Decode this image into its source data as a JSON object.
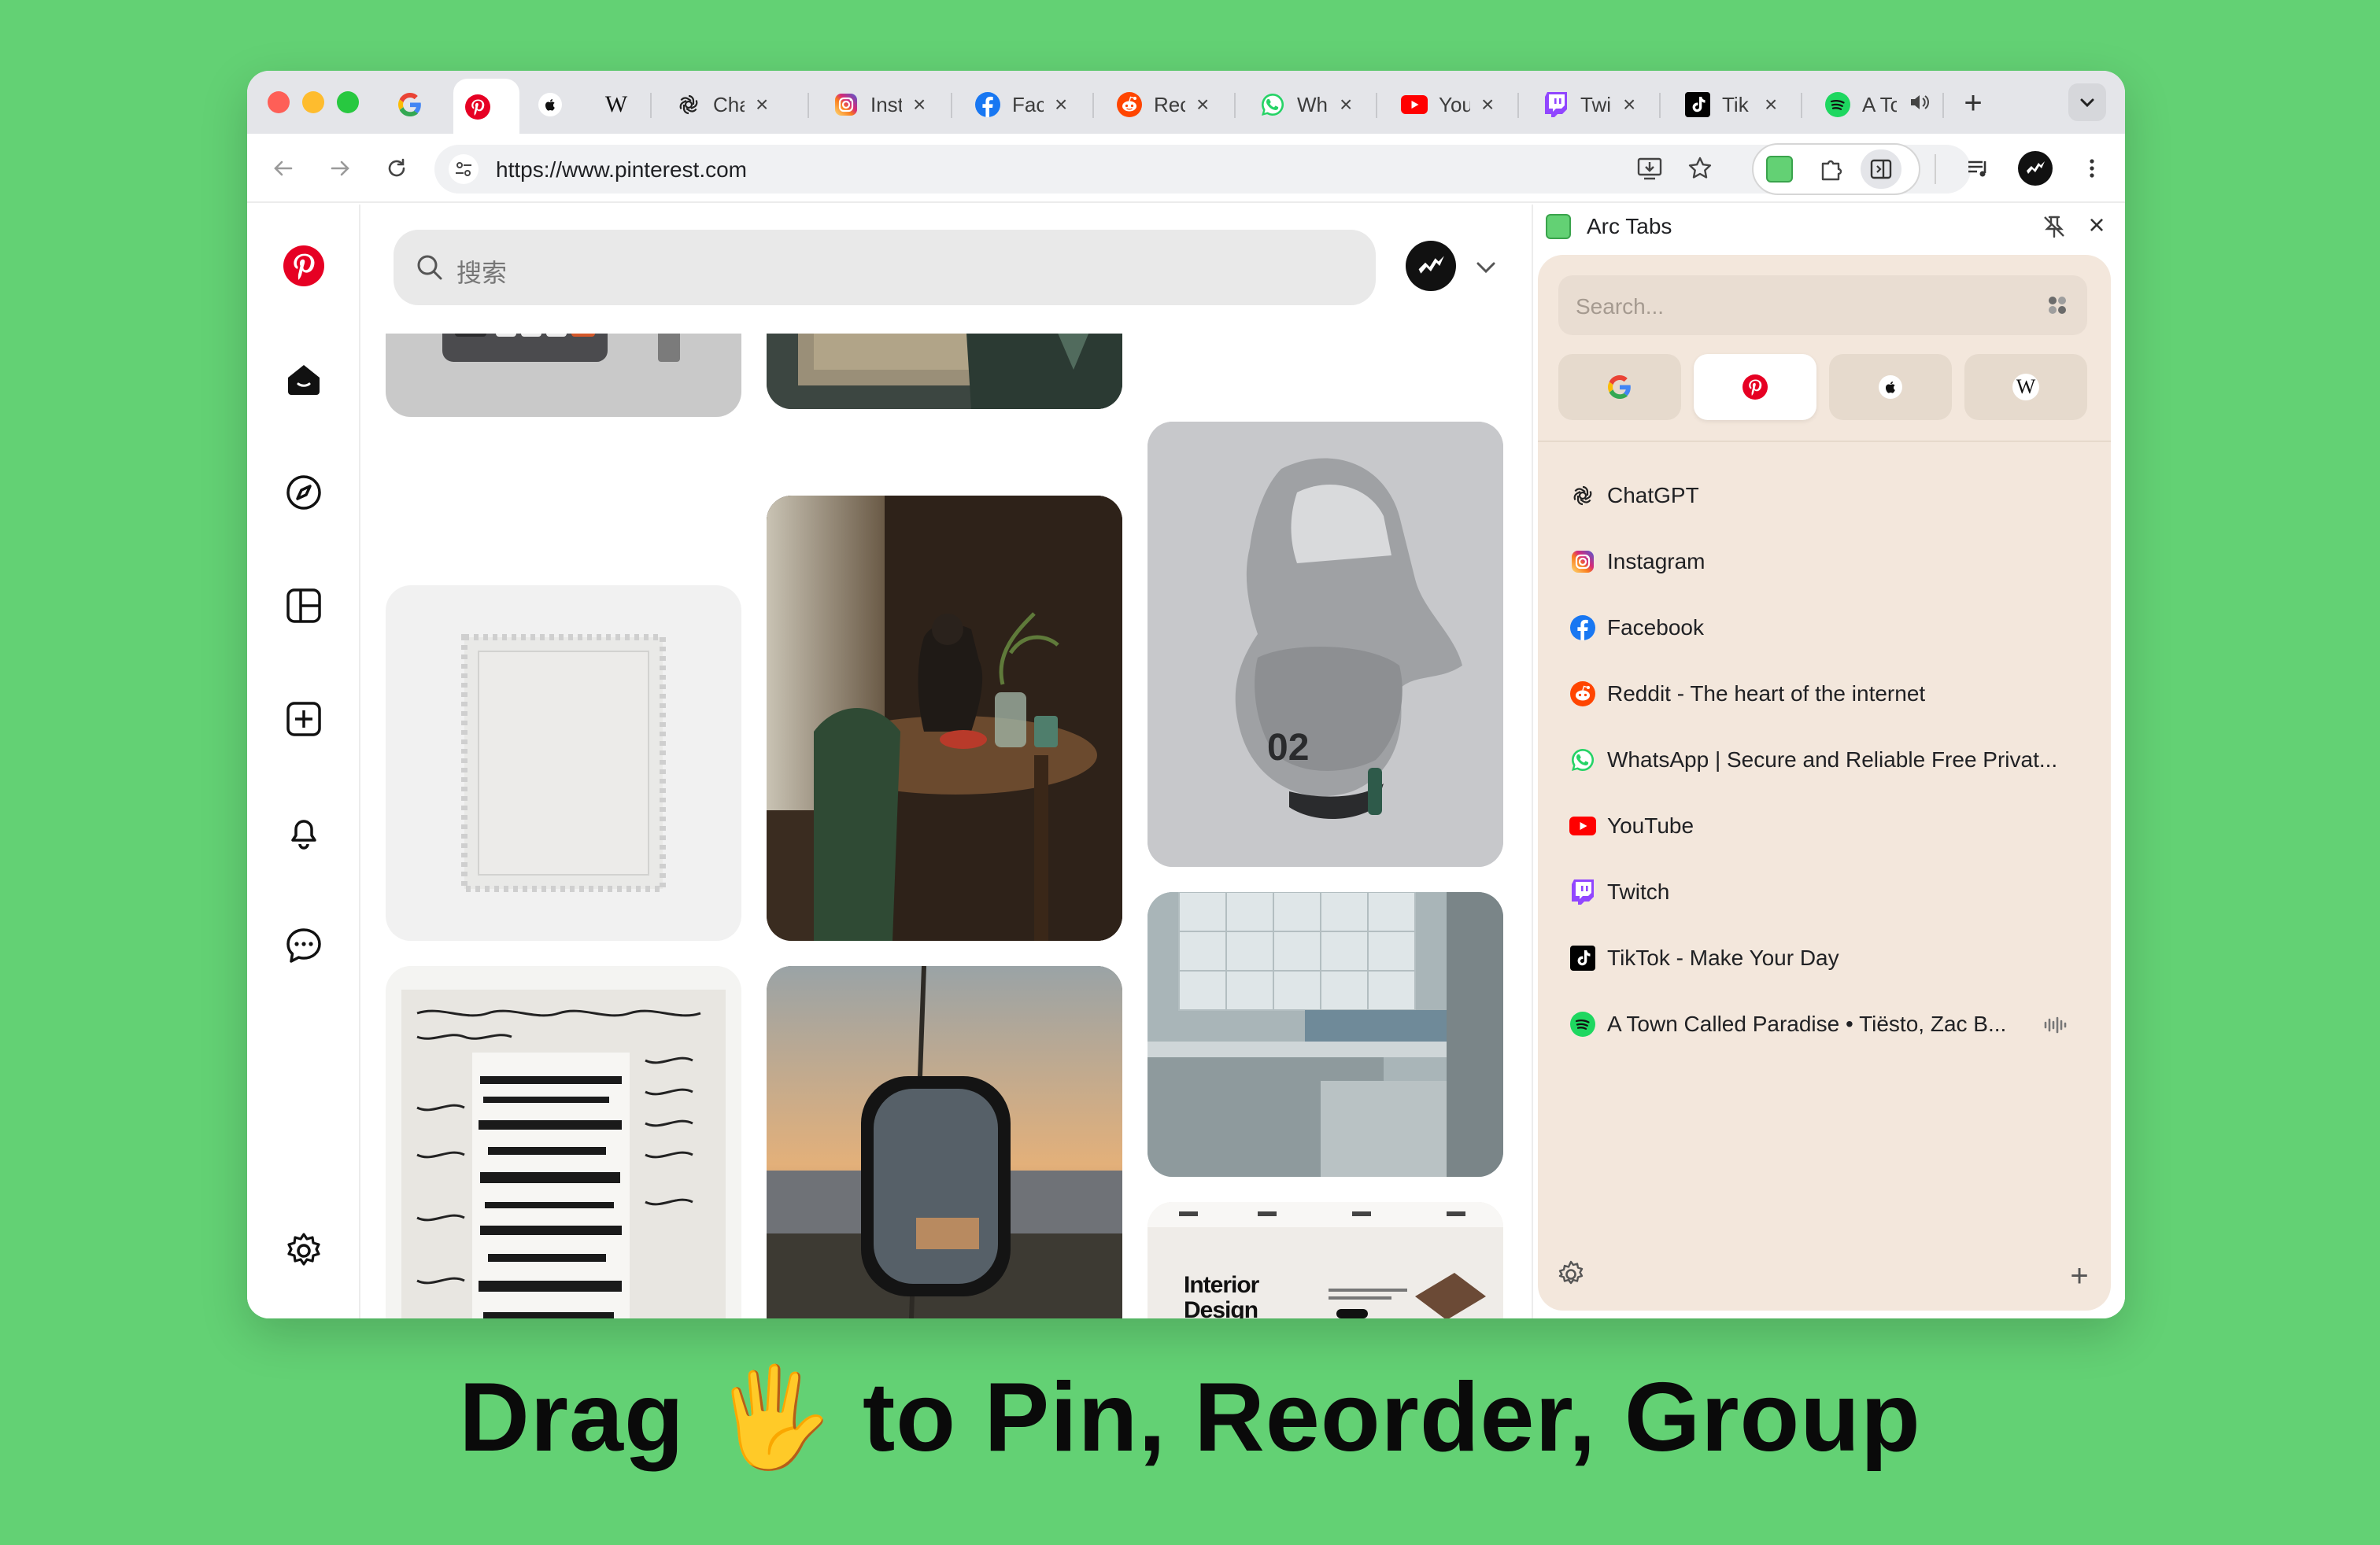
{
  "tabs": [
    {
      "name": "google",
      "label": ""
    },
    {
      "name": "pinterest",
      "label": ""
    },
    {
      "name": "apple",
      "label": ""
    },
    {
      "name": "wikipedia",
      "label": ""
    },
    {
      "name": "chatgpt",
      "label": "Cha"
    },
    {
      "name": "instagram",
      "label": "Inst"
    },
    {
      "name": "facebook",
      "label": "Fac"
    },
    {
      "name": "reddit",
      "label": "Rec"
    },
    {
      "name": "whatsapp",
      "label": "Wh"
    },
    {
      "name": "youtube",
      "label": "You"
    },
    {
      "name": "twitch",
      "label": "Twi"
    },
    {
      "name": "tiktok",
      "label": "Tik"
    },
    {
      "name": "spotify",
      "label": "A To"
    }
  ],
  "toolbar": {
    "url": "https://www.pinterest.com"
  },
  "pinterest": {
    "search_placeholder": "搜索"
  },
  "pins": [
    {
      "name": "pin-keyboard"
    },
    {
      "name": "pin-book"
    },
    {
      "name": "pin-helmet"
    },
    {
      "name": "pin-stamp"
    },
    {
      "name": "pin-cat-table"
    },
    {
      "name": "pin-kitchen"
    },
    {
      "name": "pin-manuscript"
    },
    {
      "name": "pin-sunset-mirror"
    },
    {
      "name": "pin-interior-design"
    }
  ],
  "pin_text": {
    "interior": "Interior Design",
    "helmet_number": "02"
  },
  "panel": {
    "title": "Arc Tabs",
    "search_placeholder": "Search...",
    "tabs": [
      {
        "label": "ChatGPT"
      },
      {
        "label": "Instagram"
      },
      {
        "label": "Facebook"
      },
      {
        "label": "Reddit - The heart of the internet"
      },
      {
        "label": "WhatsApp | Secure and Reliable Free Privat..."
      },
      {
        "label": "YouTube"
      },
      {
        "label": "Twitch"
      },
      {
        "label": "TikTok - Make Your Day"
      },
      {
        "label": "A Town Called Paradise • Tiësto, Zac B..."
      }
    ]
  },
  "caption": "Drag 🖐 to Pin, Reorder, Group",
  "colors": {
    "background": "#63d174",
    "panel": "#f3e7dc",
    "pinterest": "#e60023"
  }
}
